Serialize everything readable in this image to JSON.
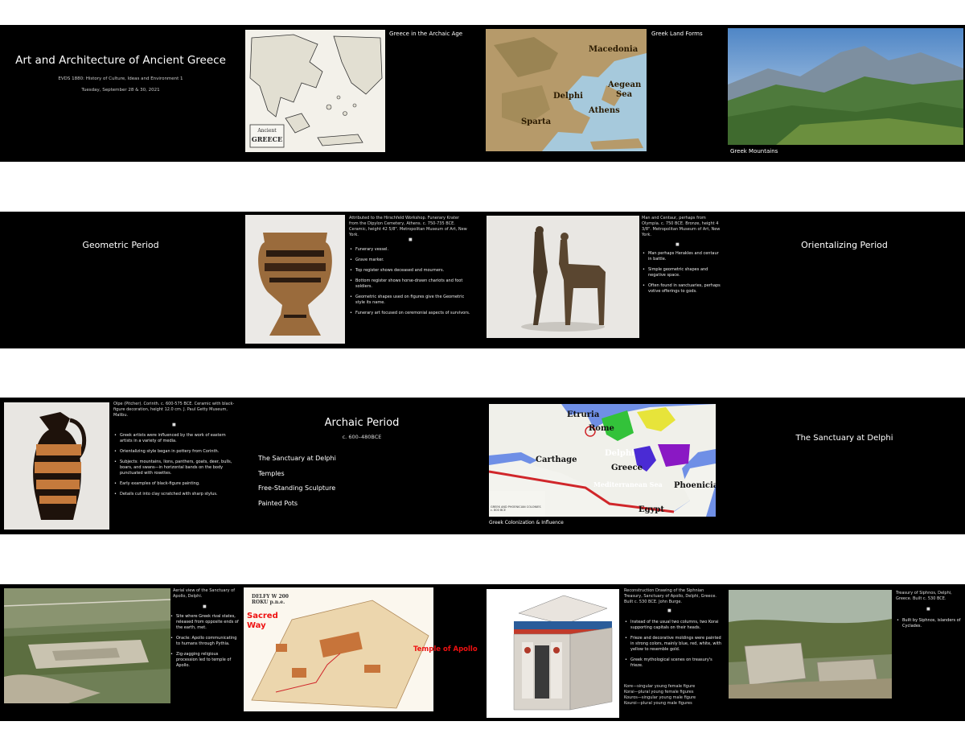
{
  "row1": {
    "title_slide": {
      "title": "Art and Architecture of Ancient Greece",
      "course": "EVDS 1880: History of Culture, Ideas and Environment 1",
      "date": "Tuesday, September 28 & 30, 2021"
    },
    "map_slide": {
      "caption": "Greece in the Archaic Age",
      "map_title_line1": "Ancient",
      "map_title_line2": "GREECE"
    },
    "landforms_slide": {
      "caption": "Greek Land Forms",
      "labels": {
        "macedonia": "Macedonia",
        "aegean": "Aegean",
        "sea": "Sea",
        "delphi": "Delphi",
        "athens": "Athens",
        "sparta": "Sparta"
      }
    },
    "mountains_slide": {
      "caption": "Greek Mountains"
    }
  },
  "row2": {
    "geometric": {
      "title": "Geometric Period"
    },
    "krater": {
      "caption": "Attributed to the Hirschfeld Workshop. Funerary Krater from the Dipylon Cemetery, Athens. c. 750-735 BCE. Ceramic, height 42 5/8\". Metropolitan Museum of Art, New York.",
      "separator": "■",
      "bullets": [
        "Funerary vessel.",
        "Grave marker.",
        "Top register shows deceased and mourners.",
        "Bottom register shows horse-drawn chariots and foot soldiers.",
        "Geometric shapes used on figures give the Geometric style its name.",
        "Funerary art focused on ceremonial aspects of survivors."
      ]
    },
    "centaur": {
      "caption": "Man and Centaur, perhaps from Olympia. c. 750 BCE. Bronze, height 4 3/8\". Metropolitan Museum of Art, New York.",
      "separator": "■",
      "bullets": [
        "Man perhaps Herakles and centaur in battle.",
        "Simple geometric shapes and negative space.",
        "Often found in sanctuaries, perhaps votive offerings to gods."
      ]
    },
    "orientalizing": {
      "title": "Orientalizing Period"
    }
  },
  "row3": {
    "olpe": {
      "caption": "Olpe (Pitcher). Corinth. c. 600-575 BCE. Ceramic with black-figure decoration, height 12.0 cm. J. Paul Getty Museum, Malibu.",
      "separator": "■",
      "bullets": [
        "Greek artists were influenced by the work of eastern artists in a variety of media.",
        "Orientalizing style began in pottery from Corinth.",
        "Subjects: mountains, lions, panthers, goats, deer, bulls, boars, and swans—in horizontal bands on the body punctuated with rosettes.",
        "Early examples of black-figure painting.",
        "Details cut into clay scratched with sharp stylus."
      ]
    },
    "archaic": {
      "title": "Archaic Period",
      "subtitle": "c. 600–480BCE",
      "items": [
        "The Sanctuary at Delphi",
        "Temples",
        "Free-Standing Sculpture",
        "Painted Pots"
      ]
    },
    "colonization": {
      "caption": "Greek Colonization & Influence",
      "labels": {
        "etruria": "Etruria",
        "rome": "Rome",
        "carthage": "Carthage",
        "delphi": "Delphi",
        "greece": "Greece",
        "med": "Mediterranean Sea",
        "phoenicia": "Phoenicia",
        "egypt": "Egypt"
      },
      "inset": "GREEK AND PHOENICIAN COLONIES c. 800 BCE"
    },
    "sanctuary": {
      "title": "The Sanctuary at Delphi"
    }
  },
  "row4": {
    "aerial": {
      "caption": "Aerial view of the Sanctuary of Apollo, Delphi.",
      "separator": "■",
      "bullets": [
        "Site where Greek rival states, released from opposite ends of the earth, met.",
        "Oracle: Apollo communicating to humans through Pythia.",
        "Zig-zagging religious procession led to temple of Apollo."
      ]
    },
    "plan": {
      "heading": "DELFY W 200 ROKU p.n.e.",
      "sacred": "Sacred",
      "way": "Way",
      "temple": "Temple of Apollo"
    },
    "treasury": {
      "caption": "Reconstruction Drawing of the Siphnian Treasury, Sanctuary of Apollo, Delphi, Greece. Built c. 530 BCE. John Burge.",
      "separator": "■",
      "bullets": [
        "Instead of the usual two columns, two Korai supporting capitals on their heads.",
        "Frieze and decorative moldings were painted in strong colors, mainly blue, red, white, with yellow to resemble gold.",
        "Greek mythological scenes on treasury's frieze."
      ],
      "notes": [
        "Kore—singular young female figure",
        "Korai—plural young female figures",
        "Kouros—singular young male figure",
        "Kouroi—plural young male figures"
      ]
    },
    "ruins": {
      "caption": "Treasury of Siphnos, Delphi, Greece. Built c. 530 BCE.",
      "separator": "■",
      "bullets": [
        "Built by Siphnos, islanders of Cyclades."
      ]
    }
  }
}
